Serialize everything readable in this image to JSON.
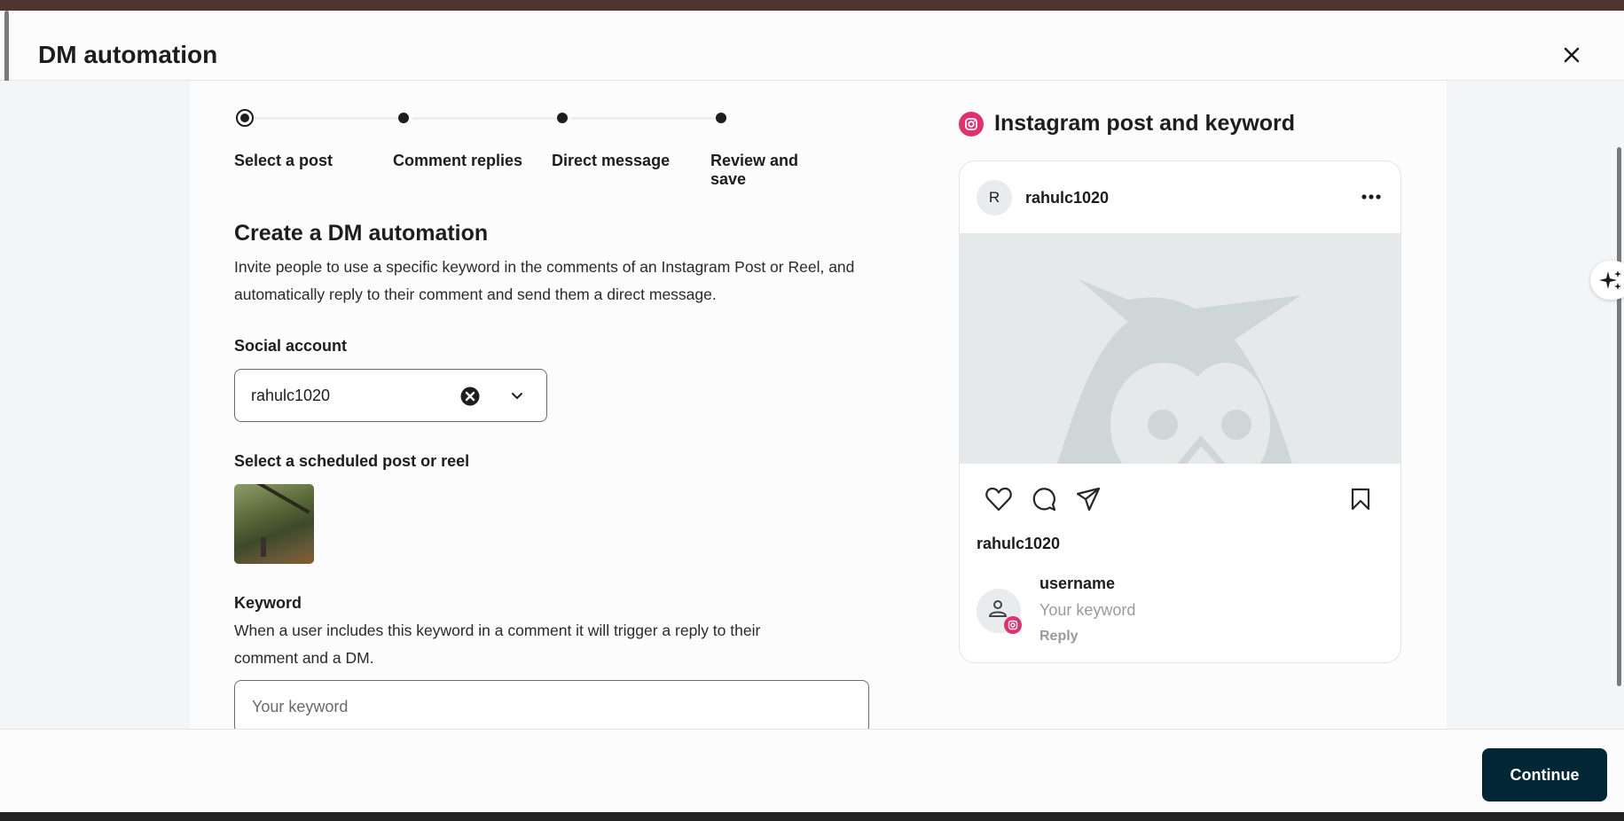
{
  "modal": {
    "title": "DM automation"
  },
  "stepper": {
    "steps": [
      {
        "label": "Select a post",
        "state": "current"
      },
      {
        "label": "Comment replies",
        "state": "upcoming"
      },
      {
        "label": "Direct message",
        "state": "upcoming"
      },
      {
        "label": "Review and save",
        "state": "upcoming"
      }
    ]
  },
  "form": {
    "heading": "Create a DM automation",
    "description": "Invite people to use a specific keyword in the comments of an Instagram Post or Reel, and automatically reply to their comment and send them a direct message.",
    "social_account_label": "Social account",
    "social_account_value": "rahulc1020",
    "post_label": "Select a scheduled post or reel",
    "keyword_label": "Keyword",
    "keyword_help": "When a user includes this keyword in a comment it will trigger a reply to their comment and a DM.",
    "keyword_placeholder": "Your keyword"
  },
  "preview": {
    "title": "Instagram post and keyword",
    "avatar_initial": "R",
    "account": "rahulc1020",
    "caption_user": "rahulc1020",
    "comment_user": "username",
    "comment_text": "Your keyword",
    "reply_label": "Reply"
  },
  "footer": {
    "continue_label": "Continue"
  },
  "colors": {
    "primary": "#012635",
    "instagram": "#e1306c"
  }
}
